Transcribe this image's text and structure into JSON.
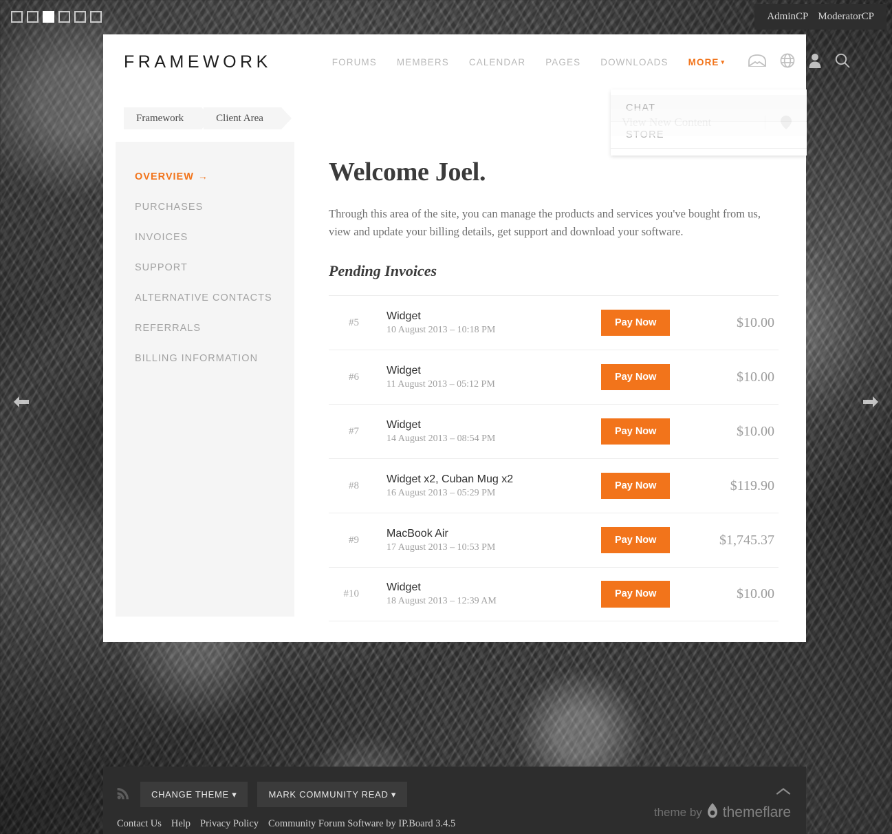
{
  "slideshow": {
    "dots": [
      "slide-1",
      "slide-2",
      "slide-3",
      "slide-4",
      "slide-5",
      "slide-6"
    ],
    "active_index": 2,
    "prev_label": "Previous slide",
    "next_label": "Next slide"
  },
  "admin_bar": {
    "links": [
      {
        "label": "AdminCP"
      },
      {
        "label": "ModeratorCP"
      }
    ]
  },
  "header": {
    "logo": "FRAMEWORK",
    "nav": [
      {
        "label": "FORUMS",
        "active": false
      },
      {
        "label": "MEMBERS",
        "active": false
      },
      {
        "label": "CALENDAR",
        "active": false
      },
      {
        "label": "PAGES",
        "active": false
      },
      {
        "label": "DOWNLOADS",
        "active": false
      },
      {
        "label": "MORE",
        "caret": "▾",
        "active": true
      }
    ],
    "icons": [
      "inbox-icon",
      "globe-icon",
      "user-icon",
      "search-icon"
    ]
  },
  "more_dropdown": {
    "items": [
      {
        "label": "CHAT"
      },
      {
        "label": "STORE"
      }
    ]
  },
  "ghost_search": {
    "placeholder": "View New Content",
    "icon": "map-pin-icon"
  },
  "breadcrumb": [
    {
      "label": "Framework"
    },
    {
      "label": "Client Area"
    }
  ],
  "sidebar": {
    "items": [
      {
        "label": "OVERVIEW",
        "active": true,
        "arrow": "→"
      },
      {
        "label": "PURCHASES",
        "active": false
      },
      {
        "label": "INVOICES",
        "active": false
      },
      {
        "label": "SUPPORT",
        "active": false
      },
      {
        "label": "ALTERNATIVE CONTACTS",
        "active": false
      },
      {
        "label": "REFERRALS",
        "active": false
      },
      {
        "label": "BILLING INFORMATION",
        "active": false
      }
    ]
  },
  "main": {
    "title": "Welcome Joel.",
    "intro": "Through this area of the site, you can manage the products and services you've bought from us, view and update your billing details, get support and download your software.",
    "section_title": "Pending Invoices",
    "pay_label": "Pay Now",
    "invoices": [
      {
        "id": "#5",
        "title": "Widget",
        "date": "10 August 2013 – 10:18 PM",
        "amount": "$10.00"
      },
      {
        "id": "#6",
        "title": "Widget",
        "date": "11 August 2013 – 05:12 PM",
        "amount": "$10.00"
      },
      {
        "id": "#7",
        "title": "Widget",
        "date": "14 August 2013 – 08:54 PM",
        "amount": "$10.00"
      },
      {
        "id": "#8",
        "title": "Widget x2, Cuban Mug x2",
        "date": "16 August 2013 – 05:29 PM",
        "amount": "$119.90"
      },
      {
        "id": "#9",
        "title": "MacBook Air",
        "date": "17 August 2013 – 10:53 PM",
        "amount": "$1,745.37"
      },
      {
        "id": "#10",
        "title": "Widget",
        "date": "18 August 2013 – 12:39 AM",
        "amount": "$10.00"
      }
    ]
  },
  "footer": {
    "rss_icon": "rss-icon",
    "buttons": [
      {
        "label": "CHANGE THEME ▾"
      },
      {
        "label": "MARK COMMUNITY READ ▾"
      }
    ],
    "links": [
      {
        "label": "Contact Us"
      },
      {
        "label": "Help"
      },
      {
        "label": "Privacy Policy"
      },
      {
        "label": "Community Forum Software by IP.Board 3.4.5"
      }
    ],
    "scroll_top_icon": "chevron-up-icon",
    "credit_prefix": "theme by",
    "credit_brand": "themeflare"
  },
  "colors": {
    "accent": "#f2741b",
    "footer_bg": "#2d2d2d",
    "panel_bg": "#f5f5f5",
    "muted_text": "#a3a3a3"
  }
}
